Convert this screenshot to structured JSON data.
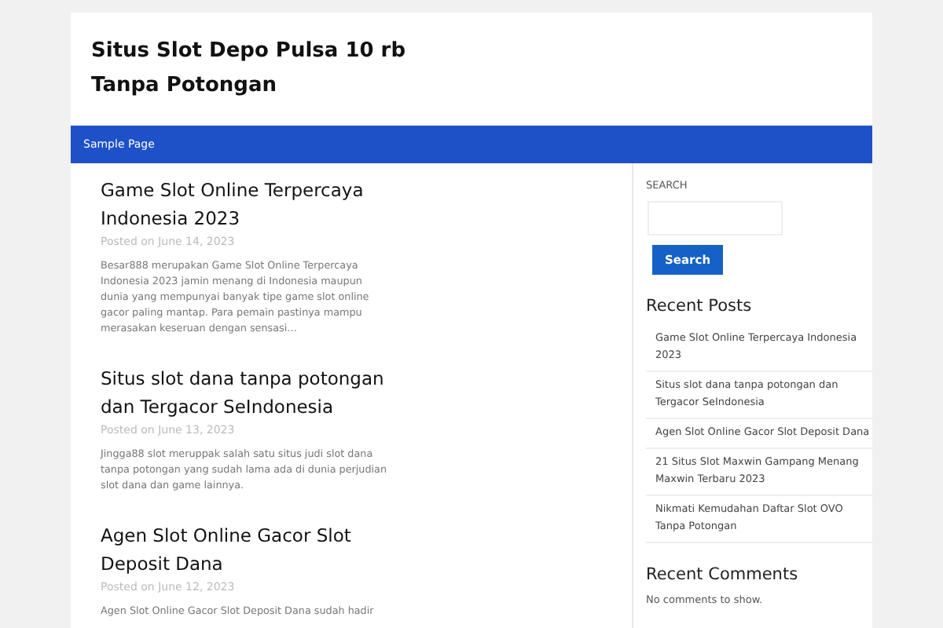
{
  "site_title": "Situs Slot Depo Pulsa 10 rb Tanpa Potongan",
  "nav": {
    "items": [
      {
        "label": "Sample Page",
        "selected": false
      }
    ]
  },
  "posts": [
    {
      "title": "Game Slot Online Terpercaya Indonesia 2023",
      "meta": "Posted on June 14, 2023",
      "excerpt": "Besar888 merupakan Game Slot Online Terpercaya Indonesia 2023 jamin menang di Indonesia maupun dunia yang mempunyai banyak tipe game slot online gacor paling mantap. Para pemain pastinya mampu merasakan keseruan dengan sensasi…"
    },
    {
      "title": "Situs slot dana tanpa potongan dan Tergacor SeIndonesia",
      "meta": "Posted on June 13, 2023",
      "excerpt": "Jingga88 slot meruppak salah satu  situs judi slot dana tanpa potongan yang sudah lama ada di dunia perjudian slot dana dan game lainnya."
    },
    {
      "title": "Agen Slot Online Gacor Slot Deposit Dana",
      "meta": "Posted on June 12, 2023",
      "excerpt": "Agen Slot Online Gacor Slot Deposit Dana sudah hadir"
    }
  ],
  "sidebar": {
    "search_label": "SEARCH",
    "search_button": "Search",
    "recent_posts_title": "Recent Posts",
    "recent_posts": [
      "Game Slot Online Terpercaya Indonesia 2023",
      "Situs slot dana tanpa potongan dan Tergacor SeIndonesia",
      "Agen Slot Online Gacor Slot Deposit Dana",
      "21 Situs Slot Maxwin Gampang Menang Maxwin Terbaru 2023",
      "Nikmati Kemudahan Daftar Slot OVO Tanpa Potongan"
    ],
    "recent_comments_title": "Recent Comments",
    "recent_comments_empty": "No comments to show."
  }
}
